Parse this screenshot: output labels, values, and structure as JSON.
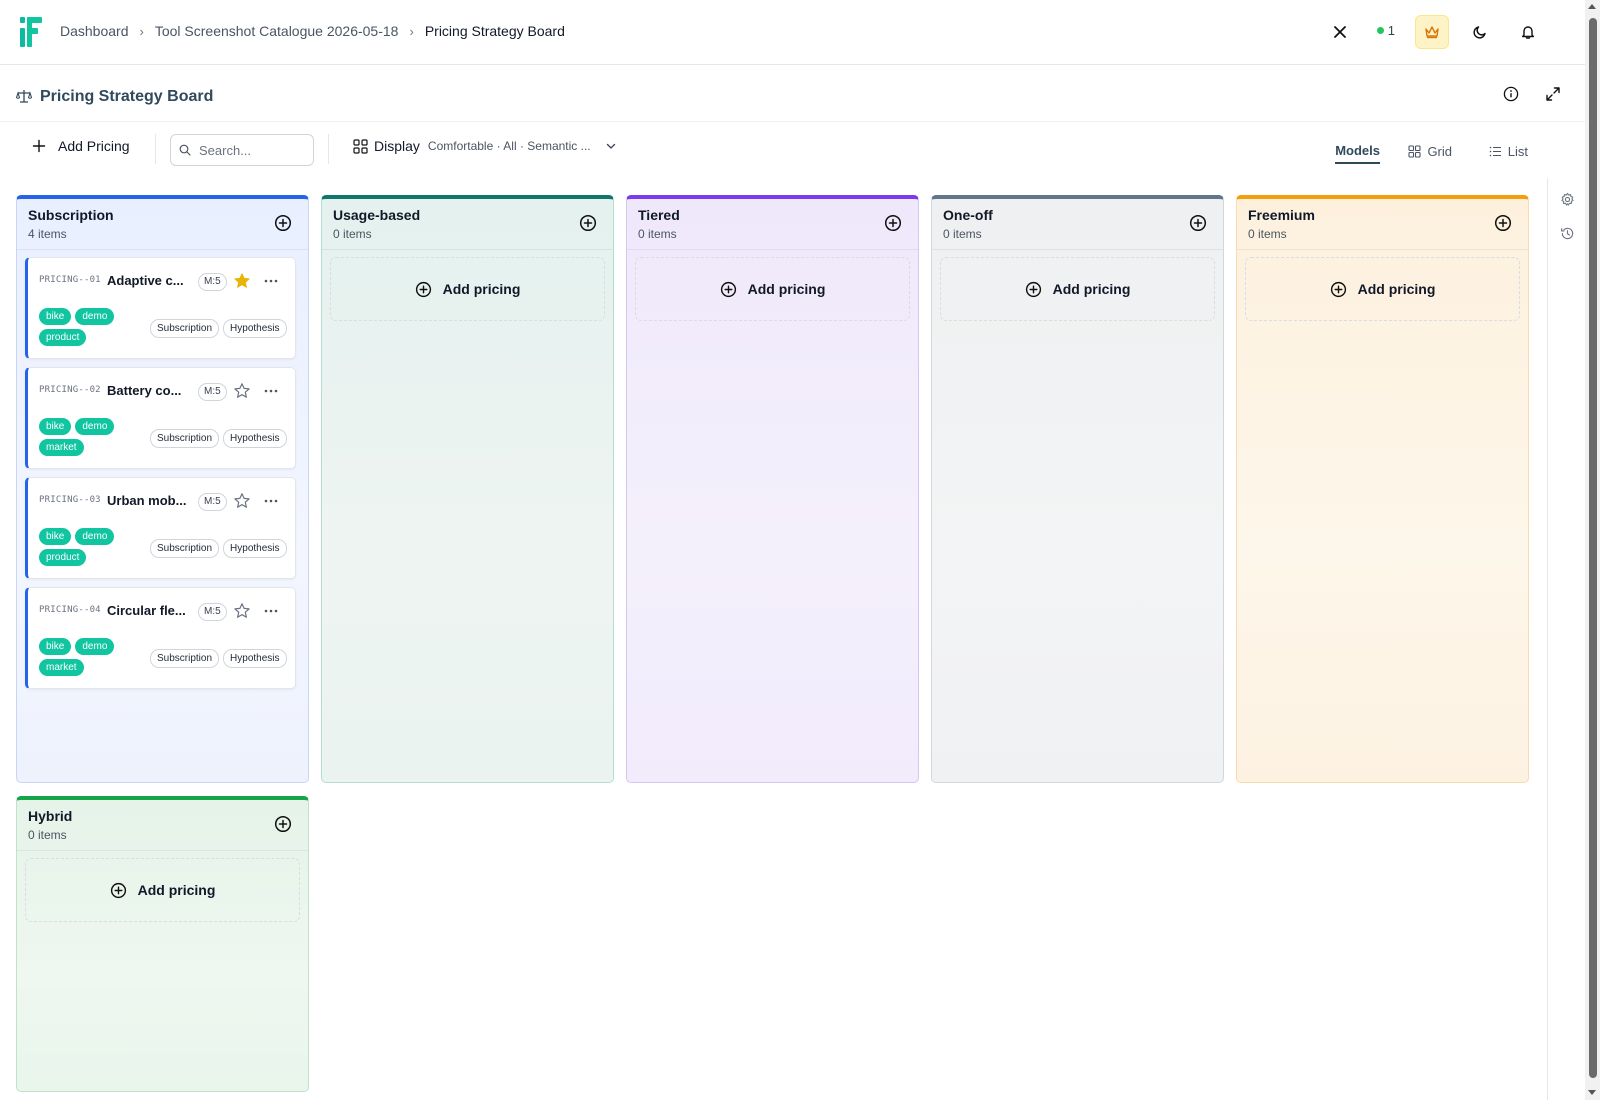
{
  "breadcrumb": [
    "Dashboard",
    "Tool Screenshot Catalogue 2026-05-18",
    "Pricing Strategy Board"
  ],
  "online_count": "1",
  "page_title": "Pricing Strategy Board",
  "toolbar": {
    "add_label": "Add Pricing",
    "search_placeholder": "Search...",
    "display_label": "Display",
    "display_summary": "Comfortable · All · Semantic ...",
    "views": [
      "Models",
      "Grid",
      "List"
    ],
    "active_view": "Models"
  },
  "columns": [
    {
      "name": "Subscription",
      "count": "4 items",
      "color": "#2563eb"
    },
    {
      "name": "Usage-based",
      "count": "0 items",
      "color": "#0f766e"
    },
    {
      "name": "Tiered",
      "count": "0 items",
      "color": "#7c3aed"
    },
    {
      "name": "One-off",
      "count": "0 items",
      "color": "#64748b"
    },
    {
      "name": "Freemium",
      "count": "0 items",
      "color": "#f59e0b"
    },
    {
      "name": "Hybrid",
      "count": "0 items",
      "color": "#16a34a"
    }
  ],
  "empty_label": "Add pricing",
  "cards": [
    {
      "code": "PRICING--01",
      "title": "Adaptive c...",
      "ms": "M:5",
      "starred": true,
      "tags": [
        "bike",
        "demo",
        "product"
      ],
      "chips": [
        "Subscription",
        "Hypothesis"
      ]
    },
    {
      "code": "PRICING--02",
      "title": "Battery co...",
      "ms": "M:5",
      "starred": false,
      "tags": [
        "bike",
        "demo",
        "market"
      ],
      "chips": [
        "Subscription",
        "Hypothesis"
      ]
    },
    {
      "code": "PRICING--03",
      "title": "Urban mob...",
      "ms": "M:5",
      "starred": false,
      "tags": [
        "bike",
        "demo",
        "product"
      ],
      "chips": [
        "Subscription",
        "Hypothesis"
      ]
    },
    {
      "code": "PRICING--04",
      "title": "Circular fle...",
      "ms": "M:5",
      "starred": false,
      "tags": [
        "bike",
        "demo",
        "market"
      ],
      "chips": [
        "Subscription",
        "Hypothesis"
      ]
    }
  ]
}
